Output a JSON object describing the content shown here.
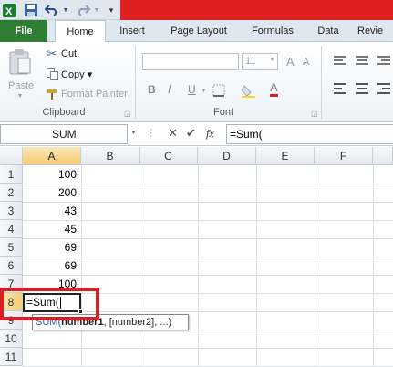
{
  "quick_access": {
    "excel_icon": "excel-logo-icon",
    "save_icon": "save-icon",
    "undo_icon": "undo-icon",
    "redo_icon": "redo-icon",
    "customize_icon": "customize-qat-icon"
  },
  "tabs": {
    "file": "File",
    "home": "Home",
    "insert": "Insert",
    "page_layout": "Page Layout",
    "formulas": "Formulas",
    "data": "Data",
    "review": "Revie"
  },
  "ribbon": {
    "clipboard": {
      "paste": "Paste",
      "cut": "Cut",
      "copy": "Copy ▾",
      "format_painter": "Format Painter",
      "group_label": "Clipboard"
    },
    "font": {
      "size": "11",
      "bold": "B",
      "italic": "I",
      "underline": "U",
      "grow": "A",
      "shrink": "A",
      "font_color": "A",
      "group_label": "Font"
    }
  },
  "formula_bar": {
    "name_box": "SUM",
    "cancel": "✕",
    "enter": "✔",
    "fx": "fx",
    "formula": "=Sum("
  },
  "sheet": {
    "columns": [
      "A",
      "B",
      "C",
      "D",
      "E",
      "F"
    ],
    "rows": [
      "1",
      "2",
      "3",
      "4",
      "5",
      "6",
      "7",
      "8",
      "9",
      "10",
      "11"
    ],
    "column_a_values": [
      "100",
      "200",
      "43",
      "45",
      "69",
      "69",
      "100"
    ],
    "active_cell_text": "=Sum(",
    "tooltip_prefix": "SUM(",
    "tooltip_bold_arg": "number1",
    "tooltip_rest": ", [number2], ...)"
  },
  "colors": {
    "title_bar": "#e02020",
    "file_tab": "#2e7d32",
    "highlight": "#d71f24",
    "selected_header": "#f5cd72"
  }
}
